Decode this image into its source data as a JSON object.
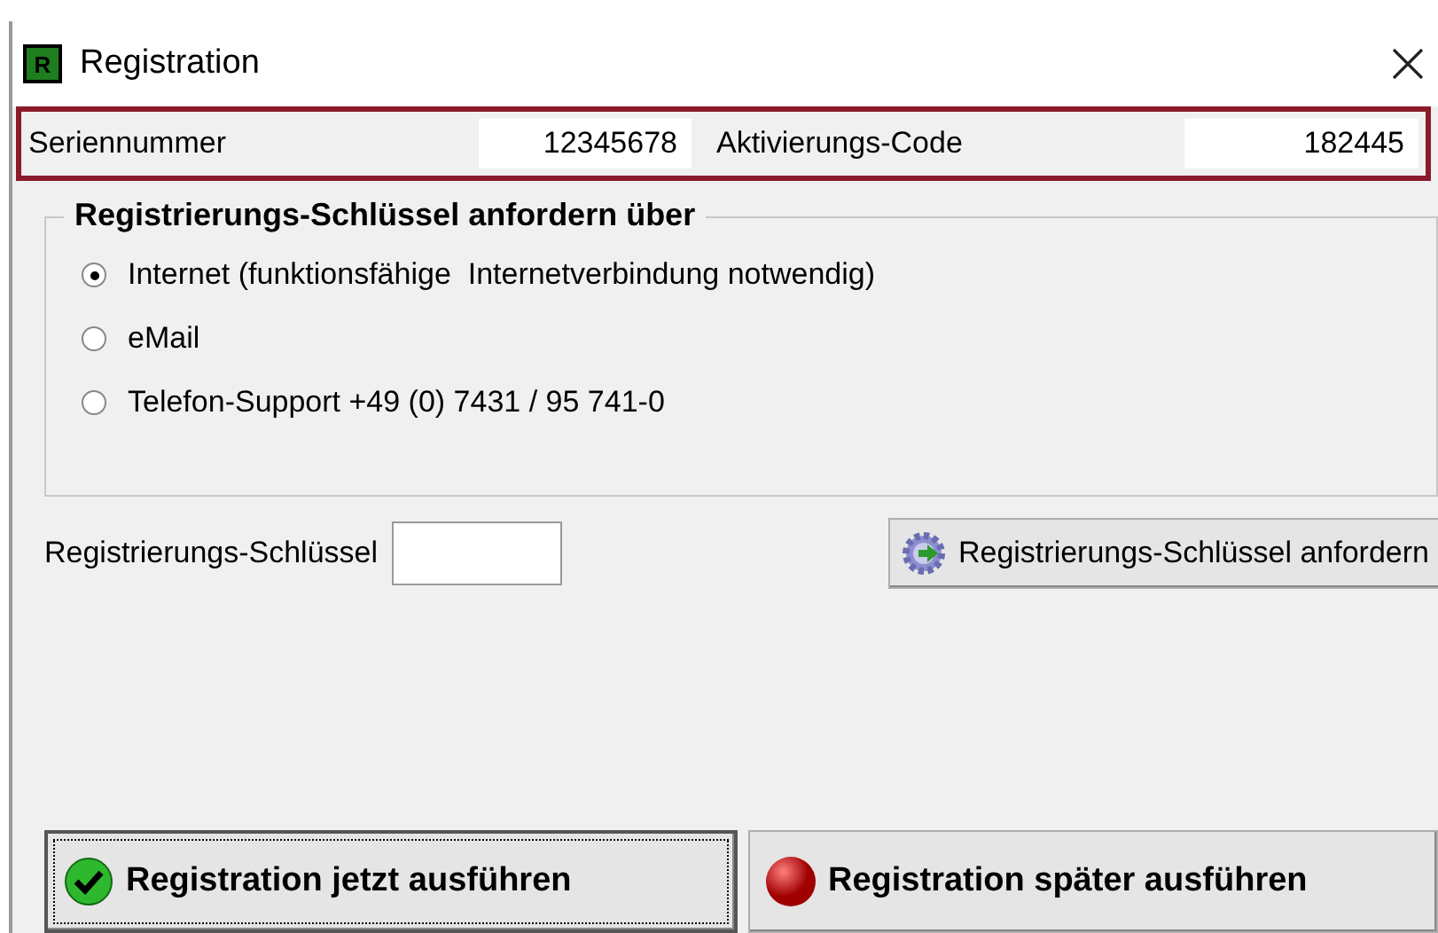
{
  "window": {
    "title": "Registration",
    "logo_text": "R"
  },
  "info": {
    "serial_label": "Seriennummer",
    "serial_value": "12345678",
    "code_label": "Aktivierungs-Code",
    "code_value": "182445"
  },
  "group": {
    "title": "Registrierungs-Schlüssel anfordern über",
    "options": [
      {
        "label": "Internet (funktionsfähige  Internetverbindung notwendig)",
        "selected": true
      },
      {
        "label": "eMail",
        "selected": false
      },
      {
        "label": "Telefon-Support +49 (0) 7431 / 95 741-0",
        "selected": false
      }
    ]
  },
  "key": {
    "label": "Registrierungs-Schlüssel",
    "request_button": "Registrierungs-Schlüssel anfordern"
  },
  "buttons": [
    {
      "label": "Registration jetzt ausführen",
      "kind": "ok",
      "focused": true
    },
    {
      "label": "Registration später ausführen",
      "kind": "later",
      "focused": false
    }
  ]
}
